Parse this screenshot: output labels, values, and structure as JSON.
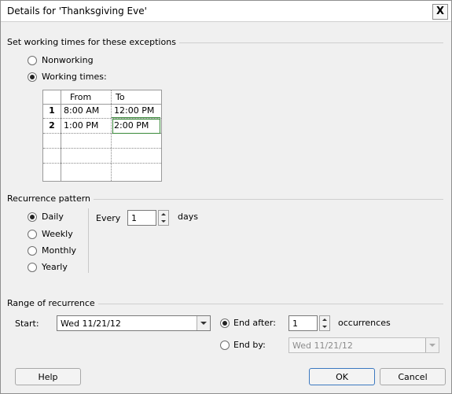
{
  "window": {
    "title": "Details for 'Thanksgiving Eve'",
    "close_symbol": "X"
  },
  "working_times": {
    "group_label": "Set working times for these exceptions",
    "nonworking_label": "Nonworking",
    "working_label": "Working times:",
    "selected": "working",
    "columns": [
      "From",
      "To"
    ],
    "rows": [
      {
        "num": "1",
        "from": "8:00 AM",
        "to": "12:00 PM"
      },
      {
        "num": "2",
        "from": "1:00 PM",
        "to": "2:00 PM"
      },
      {
        "num": "",
        "from": "",
        "to": ""
      },
      {
        "num": "",
        "from": "",
        "to": ""
      },
      {
        "num": "",
        "from": "",
        "to": ""
      },
      {
        "num": "",
        "from": "",
        "to": ""
      }
    ]
  },
  "recurrence": {
    "group_label": "Recurrence pattern",
    "options": [
      "Daily",
      "Weekly",
      "Monthly",
      "Yearly"
    ],
    "selected": "Daily",
    "every_label": "Every",
    "every_value": "1",
    "days_label": "days"
  },
  "range": {
    "group_label": "Range of recurrence",
    "start_label": "Start:",
    "start_value": "Wed 11/21/12",
    "end_after_label": "End after:",
    "end_after_value": "1",
    "occurrences_label": "occurrences",
    "end_by_label": "End by:",
    "end_by_value": "Wed 11/21/12",
    "selected": "end_after"
  },
  "buttons": {
    "help": "Help",
    "ok": "OK",
    "cancel": "Cancel"
  }
}
